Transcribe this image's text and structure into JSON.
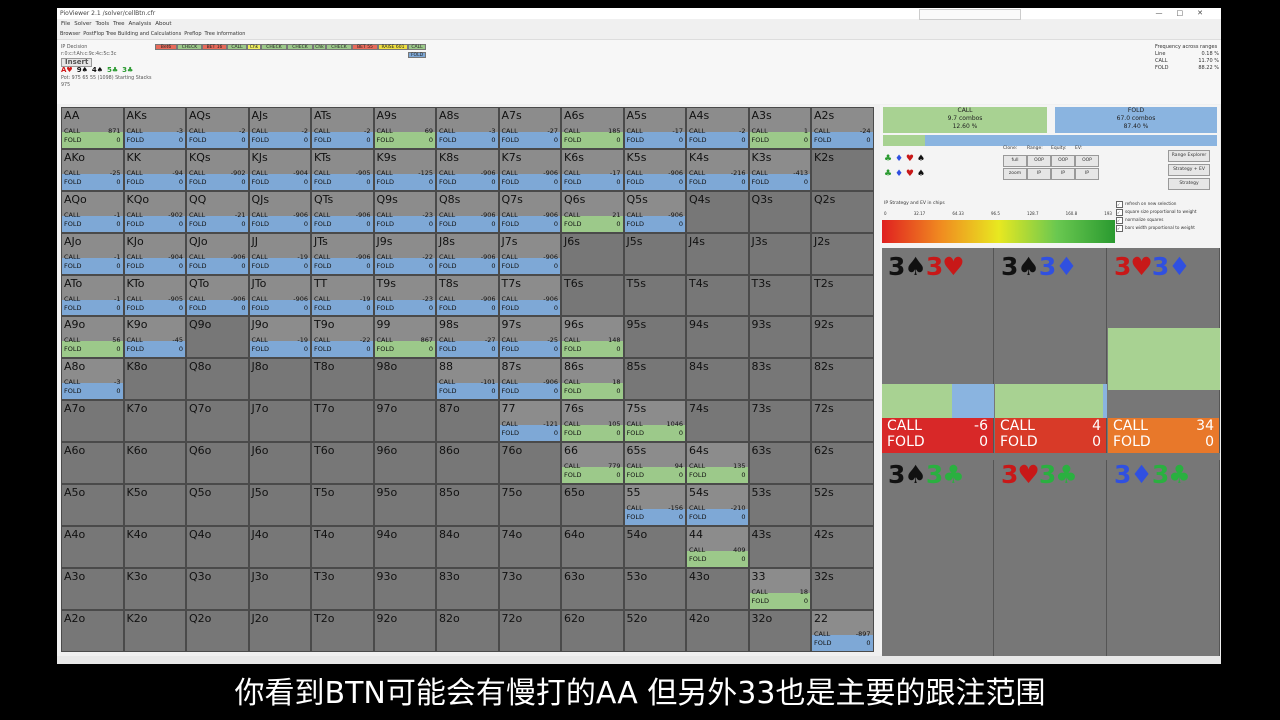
{
  "window": {
    "title": "PioViewer 2.1 /solver/cellBtn.cfr",
    "menu": [
      "File",
      "Solver",
      "Tools",
      "Tree",
      "Analysis",
      "About"
    ],
    "tabs": [
      "Browser",
      "PostFlop Tree Building and Calculations",
      "Preflop",
      "Tree information"
    ]
  },
  "info": {
    "decision": "IP Decision",
    "line": "r:0:c:f:Ah:c:9c:4c:5c:3c",
    "insert_label": "Insert",
    "board": [
      {
        "rank": "A",
        "suit": "♥",
        "color": "#d01818"
      },
      {
        "rank": "9",
        "suit": "♠",
        "color": "#111"
      },
      {
        "rank": "4",
        "suit": "♠",
        "color": "#111"
      },
      {
        "rank": "5",
        "suit": "♣",
        "color": "#2a9a30"
      },
      {
        "rank": "3",
        "suit": "♣",
        "color": "#2a9a30"
      }
    ],
    "pot": "Pot: 975 65 55 (1098) Starting Stacks 975"
  },
  "actions": [
    {
      "label": "Bet6",
      "color": "#e86a5a"
    },
    {
      "label": "CHECK",
      "color": "#9cc98a"
    },
    {
      "label": "BET 16",
      "color": "#e86a5a"
    },
    {
      "label": "CALL",
      "color": "#9cc98a"
    },
    {
      "label": "Chk",
      "color": "#f0f060"
    },
    {
      "label": "CHECK",
      "color": "#9cc98a"
    },
    {
      "label": "CHECK",
      "color": "#9cc98a"
    },
    {
      "label": "Chk",
      "color": "#9cc98a"
    },
    {
      "label": "CHECK",
      "color": "#9cc98a"
    },
    {
      "label": "BET 55",
      "color": "#e86a5a"
    },
    {
      "label": "RAISE 601",
      "color": "#f0e040"
    },
    {
      "label": "CALL",
      "color": "#9cc98a"
    },
    {
      "label": "FOLD",
      "color": "#7ea8d6"
    }
  ],
  "freq": {
    "title": "Frequency across ranges",
    "rows": [
      {
        "k": "Line",
        "v": "0.18 %"
      },
      {
        "k": "CALL",
        "v": "11.70 %"
      },
      {
        "k": "FOLD",
        "v": "88.22 %"
      }
    ]
  },
  "grid": [
    [
      [
        "AA",
        "c",
        871,
        0
      ],
      [
        "AKs",
        "f",
        -3,
        0
      ],
      [
        "AQs",
        "f",
        -2,
        0
      ],
      [
        "AJs",
        "f",
        -2,
        0
      ],
      [
        "ATs",
        "f",
        -2,
        0
      ],
      [
        "A9s",
        "c",
        69,
        0
      ],
      [
        "A8s",
        "f",
        -3,
        0
      ],
      [
        "A7s",
        "f",
        -27,
        0
      ],
      [
        "A6s",
        "c",
        185,
        0
      ],
      [
        "A5s",
        "f",
        -17,
        0
      ],
      [
        "A4s",
        "f",
        -2,
        0
      ],
      [
        "A3s",
        "c",
        1,
        0
      ],
      [
        "A2s",
        "f",
        -24,
        0
      ]
    ],
    [
      [
        "AKo",
        "f",
        -25,
        0
      ],
      [
        "KK",
        "f",
        -94,
        0
      ],
      [
        "KQs",
        "f",
        -902,
        0
      ],
      [
        "KJs",
        "f",
        -904,
        0
      ],
      [
        "KTs",
        "f",
        -905,
        0
      ],
      [
        "K9s",
        "f",
        -125,
        0
      ],
      [
        "K8s",
        "f",
        -906,
        0
      ],
      [
        "K7s",
        "f",
        -906,
        0
      ],
      [
        "K6s",
        "f",
        -17,
        0
      ],
      [
        "K5s",
        "f",
        -906,
        0
      ],
      [
        "K4s",
        "f",
        -216,
        0
      ],
      [
        "K3s",
        "f",
        -413,
        0
      ],
      [
        "K2s",
        "",
        null,
        null
      ]
    ],
    [
      [
        "AQo",
        "f",
        -1,
        0
      ],
      [
        "KQo",
        "f",
        -902,
        0
      ],
      [
        "QQ",
        "f",
        -21,
        0
      ],
      [
        "QJs",
        "f",
        -906,
        0
      ],
      [
        "QTs",
        "f",
        -906,
        0
      ],
      [
        "Q9s",
        "f",
        -23,
        0
      ],
      [
        "Q8s",
        "f",
        -906,
        0
      ],
      [
        "Q7s",
        "f",
        -906,
        0
      ],
      [
        "Q6s",
        "c",
        21,
        0
      ],
      [
        "Q5s",
        "f",
        -906,
        0
      ],
      [
        "Q4s",
        "",
        null,
        null
      ],
      [
        "Q3s",
        "",
        null,
        null
      ],
      [
        "Q2s",
        "",
        null,
        null
      ]
    ],
    [
      [
        "AJo",
        "f",
        -1,
        0
      ],
      [
        "KJo",
        "f",
        -904,
        0
      ],
      [
        "QJo",
        "f",
        -906,
        0
      ],
      [
        "JJ",
        "f",
        -19,
        0
      ],
      [
        "JTs",
        "f",
        -906,
        0
      ],
      [
        "J9s",
        "f",
        -22,
        0
      ],
      [
        "J8s",
        "f",
        -906,
        0
      ],
      [
        "J7s",
        "f",
        -906,
        0
      ],
      [
        "J6s",
        "",
        null,
        null
      ],
      [
        "J5s",
        "",
        null,
        null
      ],
      [
        "J4s",
        "",
        null,
        null
      ],
      [
        "J3s",
        "",
        null,
        null
      ],
      [
        "J2s",
        "",
        null,
        null
      ]
    ],
    [
      [
        "ATo",
        "f",
        -1,
        0
      ],
      [
        "KTo",
        "f",
        -905,
        0
      ],
      [
        "QTo",
        "f",
        -906,
        0
      ],
      [
        "JTo",
        "f",
        -906,
        0
      ],
      [
        "TT",
        "f",
        -19,
        0
      ],
      [
        "T9s",
        "f",
        -23,
        0
      ],
      [
        "T8s",
        "f",
        -906,
        0
      ],
      [
        "T7s",
        "f",
        -906,
        0
      ],
      [
        "T6s",
        "",
        null,
        null
      ],
      [
        "T5s",
        "",
        null,
        null
      ],
      [
        "T4s",
        "",
        null,
        null
      ],
      [
        "T3s",
        "",
        null,
        null
      ],
      [
        "T2s",
        "",
        null,
        null
      ]
    ],
    [
      [
        "A9o",
        "c",
        56,
        0
      ],
      [
        "K9o",
        "f",
        -45,
        0
      ],
      [
        "Q9o",
        "",
        null,
        null
      ],
      [
        "J9o",
        "f",
        -19,
        0
      ],
      [
        "T9o",
        "f",
        -22,
        0
      ],
      [
        "99",
        "c",
        867,
        0
      ],
      [
        "98s",
        "f",
        -27,
        0
      ],
      [
        "97s",
        "f",
        -25,
        0
      ],
      [
        "96s",
        "c",
        148,
        0
      ],
      [
        "95s",
        "",
        null,
        null
      ],
      [
        "94s",
        "",
        null,
        null
      ],
      [
        "93s",
        "",
        null,
        null
      ],
      [
        "92s",
        "",
        null,
        null
      ]
    ],
    [
      [
        "A8o",
        "f",
        -3,
        0
      ],
      [
        "K8o",
        "",
        null,
        null
      ],
      [
        "Q8o",
        "",
        null,
        null
      ],
      [
        "J8o",
        "",
        null,
        null
      ],
      [
        "T8o",
        "",
        null,
        null
      ],
      [
        "98o",
        "",
        null,
        null
      ],
      [
        "88",
        "f",
        -101,
        0
      ],
      [
        "87s",
        "f",
        -906,
        0
      ],
      [
        "86s",
        "c",
        18,
        0
      ],
      [
        "85s",
        "",
        null,
        null
      ],
      [
        "84s",
        "",
        null,
        null
      ],
      [
        "83s",
        "",
        null,
        null
      ],
      [
        "82s",
        "",
        null,
        null
      ]
    ],
    [
      [
        "A7o",
        "",
        null,
        null
      ],
      [
        "K7o",
        "",
        null,
        null
      ],
      [
        "Q7o",
        "",
        null,
        null
      ],
      [
        "J7o",
        "",
        null,
        null
      ],
      [
        "T7o",
        "",
        null,
        null
      ],
      [
        "97o",
        "",
        null,
        null
      ],
      [
        "87o",
        "",
        null,
        null
      ],
      [
        "77",
        "f",
        -121,
        0
      ],
      [
        "76s",
        "c",
        105,
        0
      ],
      [
        "75s",
        "c",
        1046,
        0
      ],
      [
        "74s",
        "",
        null,
        null
      ],
      [
        "73s",
        "",
        null,
        null
      ],
      [
        "72s",
        "",
        null,
        null
      ]
    ],
    [
      [
        "A6o",
        "",
        null,
        null
      ],
      [
        "K6o",
        "",
        null,
        null
      ],
      [
        "Q6o",
        "",
        null,
        null
      ],
      [
        "J6o",
        "",
        null,
        null
      ],
      [
        "T6o",
        "",
        null,
        null
      ],
      [
        "96o",
        "",
        null,
        null
      ],
      [
        "86o",
        "",
        null,
        null
      ],
      [
        "76o",
        "",
        null,
        null
      ],
      [
        "66",
        "c",
        779,
        0
      ],
      [
        "65s",
        "c",
        94,
        0
      ],
      [
        "64s",
        "c",
        135,
        0
      ],
      [
        "63s",
        "",
        null,
        null
      ],
      [
        "62s",
        "",
        null,
        null
      ]
    ],
    [
      [
        "A5o",
        "",
        null,
        null
      ],
      [
        "K5o",
        "",
        null,
        null
      ],
      [
        "Q5o",
        "",
        null,
        null
      ],
      [
        "J5o",
        "",
        null,
        null
      ],
      [
        "T5o",
        "",
        null,
        null
      ],
      [
        "95o",
        "",
        null,
        null
      ],
      [
        "85o",
        "",
        null,
        null
      ],
      [
        "75o",
        "",
        null,
        null
      ],
      [
        "65o",
        "",
        null,
        null
      ],
      [
        "55",
        "f",
        -156,
        0
      ],
      [
        "54s",
        "f",
        -210,
        0
      ],
      [
        "53s",
        "",
        null,
        null
      ],
      [
        "52s",
        "",
        null,
        null
      ]
    ],
    [
      [
        "A4o",
        "",
        null,
        null
      ],
      [
        "K4o",
        "",
        null,
        null
      ],
      [
        "Q4o",
        "",
        null,
        null
      ],
      [
        "J4o",
        "",
        null,
        null
      ],
      [
        "T4o",
        "",
        null,
        null
      ],
      [
        "94o",
        "",
        null,
        null
      ],
      [
        "84o",
        "",
        null,
        null
      ],
      [
        "74o",
        "",
        null,
        null
      ],
      [
        "64o",
        "",
        null,
        null
      ],
      [
        "54o",
        "",
        null,
        null
      ],
      [
        "44",
        "c",
        409,
        0
      ],
      [
        "43s",
        "",
        null,
        null
      ],
      [
        "42s",
        "",
        null,
        null
      ]
    ],
    [
      [
        "A3o",
        "",
        null,
        null
      ],
      [
        "K3o",
        "",
        null,
        null
      ],
      [
        "Q3o",
        "",
        null,
        null
      ],
      [
        "J3o",
        "",
        null,
        null
      ],
      [
        "T3o",
        "",
        null,
        null
      ],
      [
        "93o",
        "",
        null,
        null
      ],
      [
        "83o",
        "",
        null,
        null
      ],
      [
        "73o",
        "",
        null,
        null
      ],
      [
        "63o",
        "",
        null,
        null
      ],
      [
        "53o",
        "",
        null,
        null
      ],
      [
        "43o",
        "",
        null,
        null
      ],
      [
        "33",
        "c",
        18,
        0
      ],
      [
        "32s",
        "",
        null,
        null
      ]
    ],
    [
      [
        "A2o",
        "",
        null,
        null
      ],
      [
        "K2o",
        "",
        null,
        null
      ],
      [
        "Q2o",
        "",
        null,
        null
      ],
      [
        "J2o",
        "",
        null,
        null
      ],
      [
        "T2o",
        "",
        null,
        null
      ],
      [
        "92o",
        "",
        null,
        null
      ],
      [
        "82o",
        "",
        null,
        null
      ],
      [
        "72o",
        "",
        null,
        null
      ],
      [
        "62o",
        "",
        null,
        null
      ],
      [
        "52o",
        "",
        null,
        null
      ],
      [
        "42o",
        "",
        null,
        null
      ],
      [
        "32o",
        "",
        null,
        null
      ],
      [
        "22",
        "f",
        -897,
        0
      ]
    ]
  ],
  "grid_labels": {
    "call": "CALL",
    "fold": "FOLD"
  },
  "summary": {
    "call": {
      "label": "CALL",
      "combos": "9.7 combos",
      "pct": "12.60 %",
      "frac": 0.126
    },
    "fold": {
      "label": "FOLD",
      "combos": "67.0 combos",
      "pct": "87.40 %"
    }
  },
  "panel": {
    "buttons": [
      {
        "cap": "Clone:",
        "b": [
          "full",
          "zoom"
        ]
      },
      {
        "cap": "Range:",
        "b": [
          "OOP",
          "IP"
        ]
      },
      {
        "cap": "Equity:",
        "b": [
          "OOP",
          "IP"
        ]
      },
      {
        "cap": "EV:",
        "b": [
          "OOP",
          "IP"
        ]
      }
    ],
    "range_explorer": "Range Explorer",
    "strategy_ev": "Strategy + EV",
    "strategy": "Strategy",
    "checks": [
      "refresh on new selection",
      "square size proportional to weight",
      "normalize squares",
      "bars width proportional to weight"
    ],
    "ev_label": "IP Strategy and EV in chips",
    "scale": [
      "0",
      "32.17",
      "64.33",
      "96.5",
      "128.7",
      "160.8",
      "193"
    ]
  },
  "combos": [
    {
      "cards": [
        [
          "3",
          "♠",
          "#111"
        ],
        [
          "3",
          "♥",
          "#c81818"
        ]
      ],
      "call": -6,
      "fold": 0,
      "res_color": "#d82828"
    },
    {
      "cards": [
        [
          "3",
          "♠",
          "#111"
        ],
        [
          "3",
          "♦",
          "#3050e0"
        ]
      ],
      "call": 4,
      "fold": 0,
      "res_color": "#d83a28"
    },
    {
      "cards": [
        [
          "3",
          "♥",
          "#c81818"
        ],
        [
          "3",
          "♦",
          "#3050e0"
        ]
      ],
      "call": 34,
      "fold": 0,
      "res_color": "#e8782a"
    },
    {
      "cards": [
        [
          "3",
          "♠",
          "#111"
        ],
        [
          "3",
          "♣",
          "#2ab040"
        ]
      ]
    },
    {
      "cards": [
        [
          "3",
          "♥",
          "#c81818"
        ],
        [
          "3",
          "♣",
          "#2ab040"
        ]
      ]
    },
    {
      "cards": [
        [
          "3",
          "♦",
          "#3050e0"
        ],
        [
          "3",
          "♣",
          "#2ab040"
        ]
      ]
    }
  ],
  "subtitle": "你看到BTN可能会有慢打的AA 但另外33也是主要的跟注范围"
}
